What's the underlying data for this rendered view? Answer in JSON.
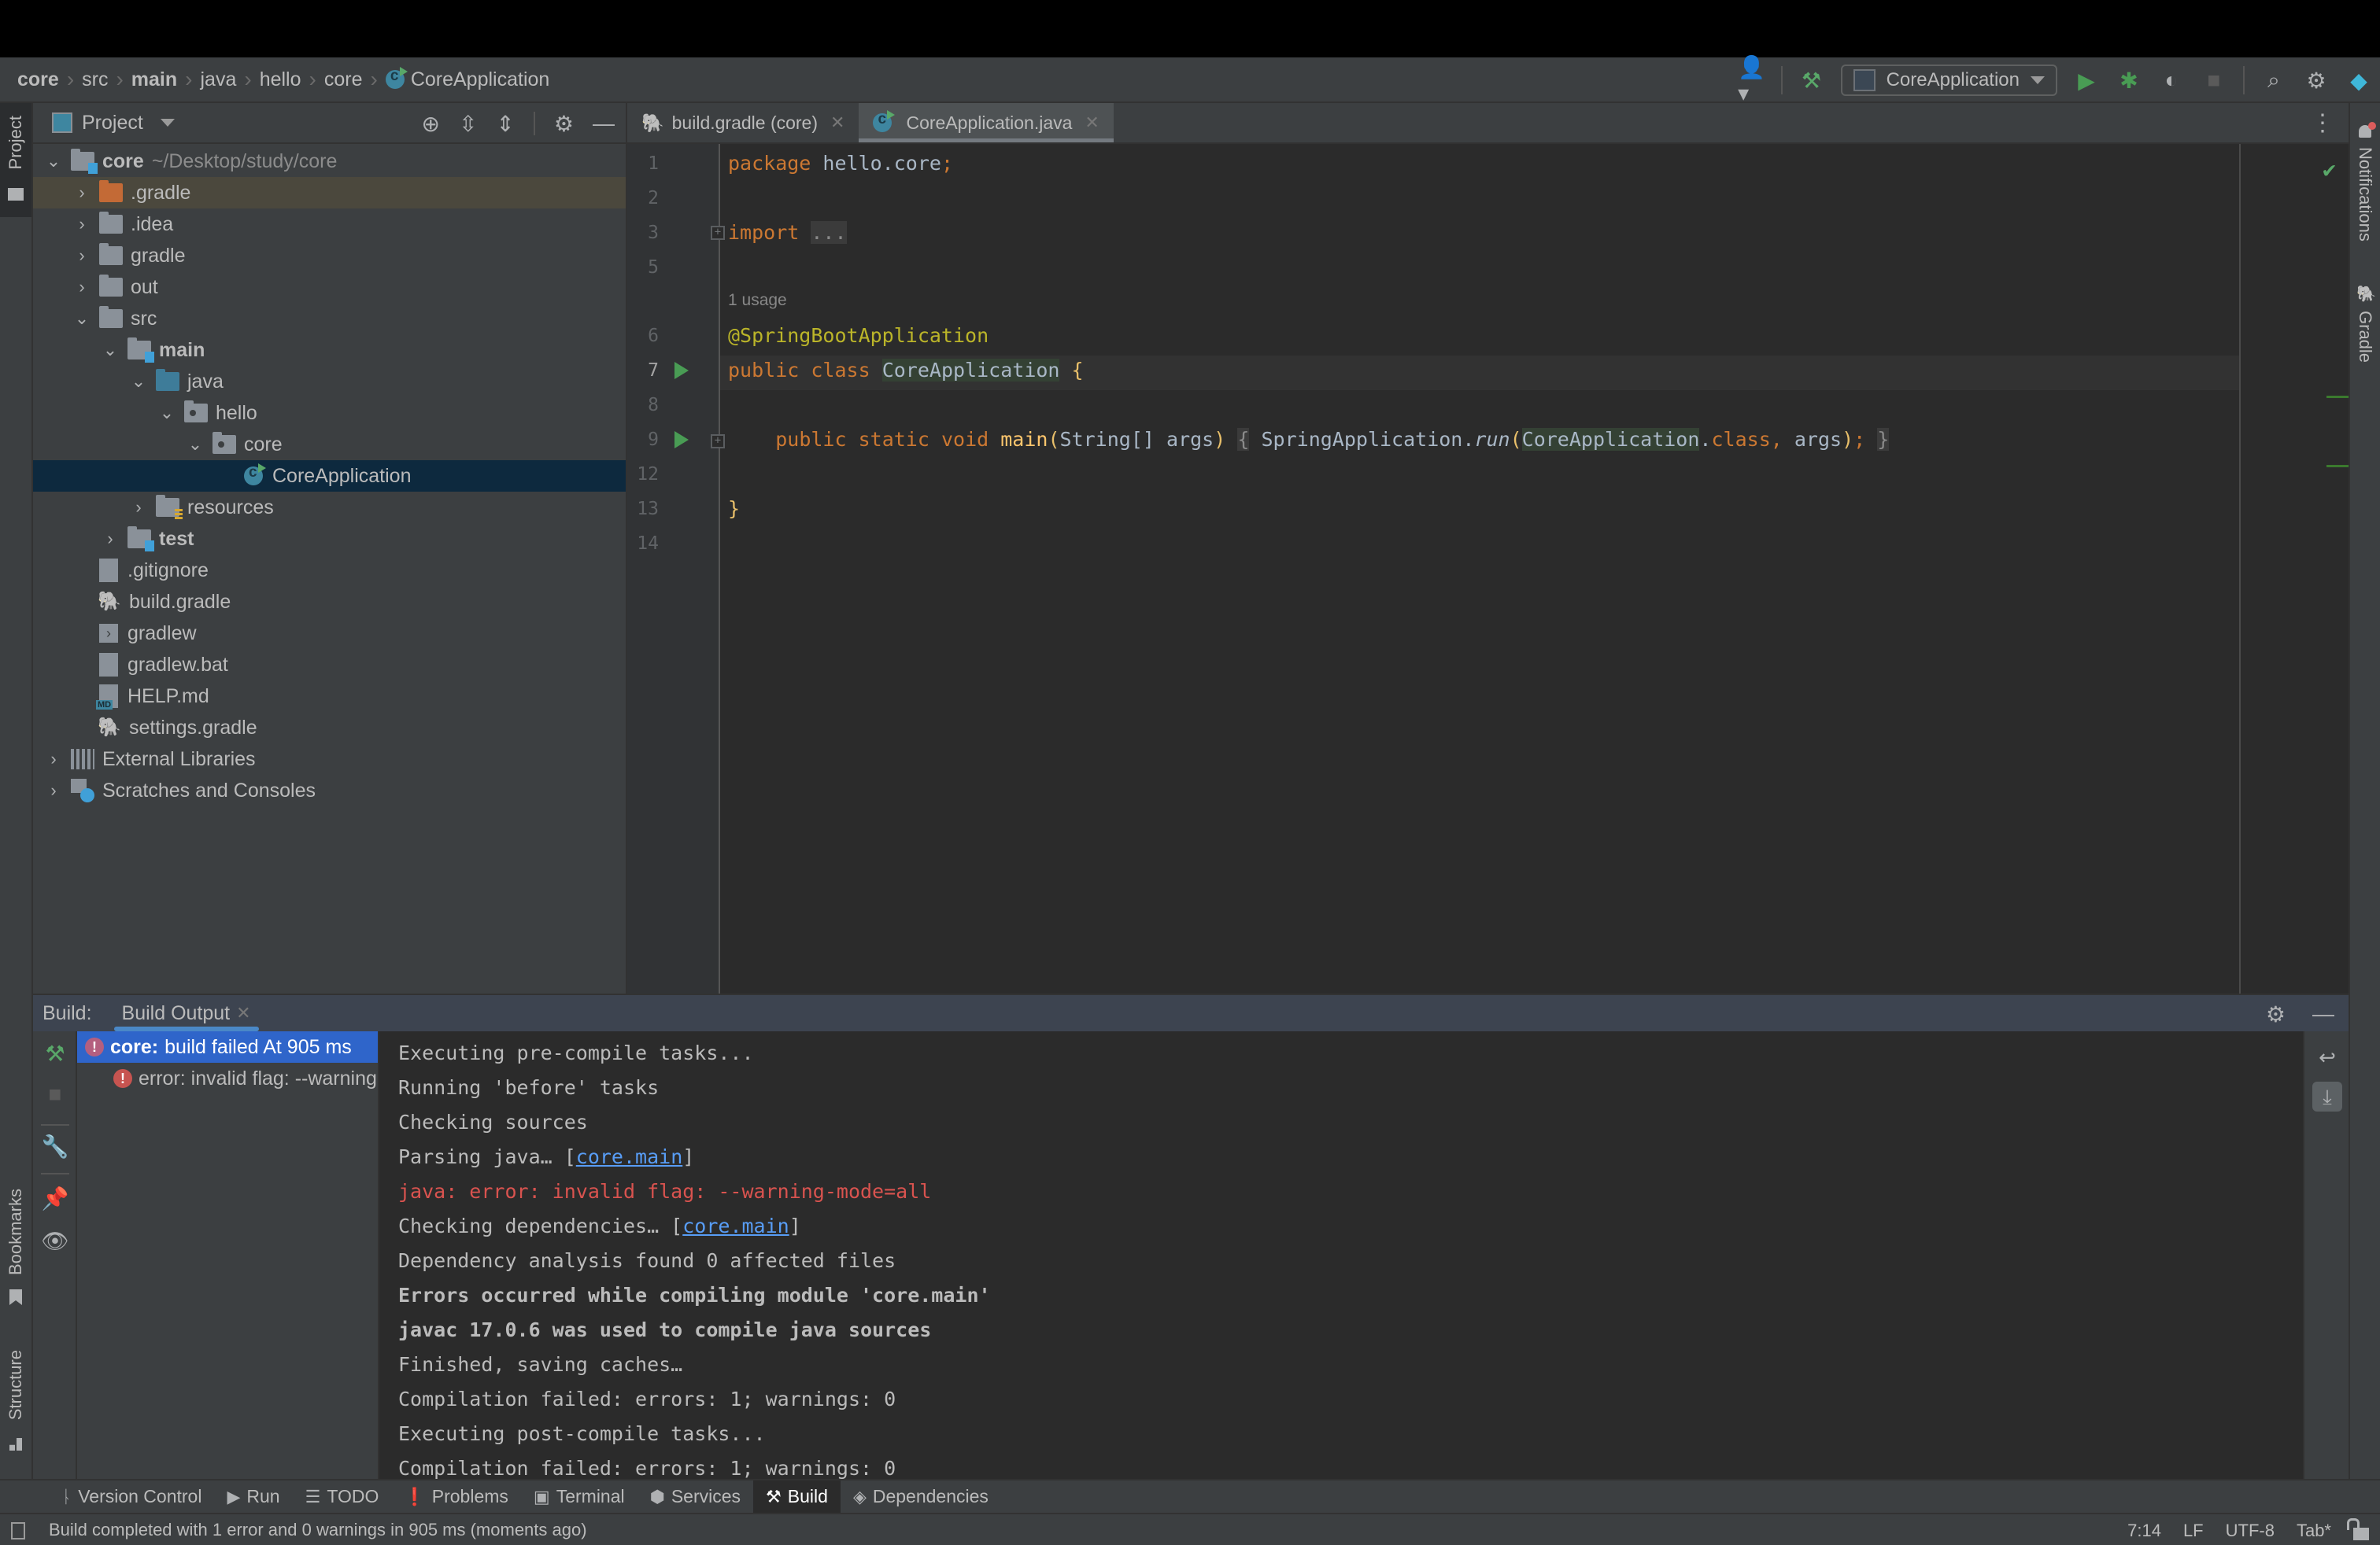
{
  "breadcrumb": [
    {
      "label": "core",
      "bold": true
    },
    {
      "label": "src",
      "bold": false
    },
    {
      "label": "main",
      "bold": true
    },
    {
      "label": "java",
      "bold": false
    },
    {
      "label": "hello",
      "bold": false
    },
    {
      "label": "core",
      "bold": false
    },
    {
      "label": "CoreApplication",
      "bold": false,
      "icon": "class-icon"
    }
  ],
  "toolbar": {
    "run_config": "CoreApplication",
    "icons": [
      "vcs-user-icon",
      "build-hammer-icon",
      "run-icon",
      "debug-icon",
      "coverage-icon",
      "stop-icon",
      "search-icon",
      "settings-icon",
      "jetbrains-logo-icon"
    ]
  },
  "project_panel": {
    "title": "Project",
    "stripe_label": "Project",
    "tree": [
      {
        "label": "core",
        "path": "~/Desktop/study/core",
        "level": 0,
        "expanded": true,
        "icon": "module-folder",
        "bold": true
      },
      {
        "label": ".gradle",
        "level": 1,
        "expanded": false,
        "icon": "folder-orange",
        "highlight": true
      },
      {
        "label": ".idea",
        "level": 1,
        "expanded": false,
        "icon": "folder"
      },
      {
        "label": "gradle",
        "level": 1,
        "expanded": false,
        "icon": "folder"
      },
      {
        "label": "out",
        "level": 1,
        "expanded": false,
        "icon": "folder"
      },
      {
        "label": "src",
        "level": 1,
        "expanded": true,
        "icon": "folder"
      },
      {
        "label": "main",
        "level": 2,
        "expanded": true,
        "icon": "source-root",
        "bold": true
      },
      {
        "label": "java",
        "level": 3,
        "expanded": true,
        "icon": "folder-blue"
      },
      {
        "label": "hello",
        "level": 4,
        "expanded": true,
        "icon": "package"
      },
      {
        "label": "core",
        "level": 5,
        "expanded": true,
        "icon": "package"
      },
      {
        "label": "CoreApplication",
        "level": 6,
        "icon": "class",
        "selected": true
      },
      {
        "label": "resources",
        "level": 3,
        "expanded": false,
        "icon": "resources-root"
      },
      {
        "label": "test",
        "level": 2,
        "expanded": false,
        "icon": "source-root",
        "bold": true
      },
      {
        "label": ".gitignore",
        "level": 1,
        "icon": "ignore-file"
      },
      {
        "label": "build.gradle",
        "level": 1,
        "icon": "gradle"
      },
      {
        "label": "gradlew",
        "level": 1,
        "icon": "shell"
      },
      {
        "label": "gradlew.bat",
        "level": 1,
        "icon": "text-file"
      },
      {
        "label": "HELP.md",
        "level": 1,
        "icon": "markdown"
      },
      {
        "label": "settings.gradle",
        "level": 1,
        "icon": "gradle"
      },
      {
        "label": "External Libraries",
        "level": 0,
        "expanded": false,
        "icon": "libraries"
      },
      {
        "label": "Scratches and Consoles",
        "level": 0,
        "expanded": false,
        "icon": "scratches"
      }
    ]
  },
  "editor": {
    "tabs": [
      {
        "label": "build.gradle (core)",
        "icon": "gradle-icon",
        "active": false
      },
      {
        "label": "CoreApplication.java",
        "icon": "class-icon",
        "active": true
      }
    ],
    "usage_hint": "1 usage",
    "lines": [
      {
        "n": "1",
        "code": "package hello.core;"
      },
      {
        "n": "2",
        "code": ""
      },
      {
        "n": "3",
        "code": "import ..."
      },
      {
        "n": "5",
        "code": ""
      },
      {
        "n": "6",
        "code": "@SpringBootApplication"
      },
      {
        "n": "7",
        "code": "public class CoreApplication {"
      },
      {
        "n": "8",
        "code": ""
      },
      {
        "n": "9",
        "code": "    public static void main(String[] args) { SpringApplication.run(CoreApplication.class, args); }"
      },
      {
        "n": "12",
        "code": ""
      },
      {
        "n": "13",
        "code": "}"
      },
      {
        "n": "14",
        "code": ""
      }
    ],
    "tokens": {
      "package_kw": "package",
      "package_name": "hello.core",
      "import_kw": "import",
      "import_fold": "...",
      "annotation": "@SpringBootApplication",
      "public_kw": "public",
      "class_kw": "class",
      "class_name": "CoreApplication",
      "static_kw": "static",
      "void_kw": "void",
      "method_name": "main",
      "param_type": "String[]",
      "param_name": "args",
      "call_target": "SpringApplication",
      "call_method": "run",
      "class_lit_kw": "class"
    },
    "inspection_status": "no-problems"
  },
  "right_stripe": {
    "items": [
      "Notifications",
      "Gradle"
    ]
  },
  "left_stripe_bottom": [
    "Bookmarks",
    "Structure"
  ],
  "build_panel": {
    "label": "Build:",
    "tab": "Build Output",
    "tree": [
      {
        "prefix": "core:",
        "text": "build failed At 905 ms",
        "selected": true,
        "level": 0
      },
      {
        "prefix": "",
        "text": "error: invalid flag: --warning-mode=all",
        "visible_text": "error: invalid flag: --warn",
        "selected": false,
        "level": 1
      }
    ],
    "console": [
      {
        "text": "Executing pre-compile tasks...",
        "style": "normal"
      },
      {
        "text": "Running 'before' tasks",
        "style": "normal"
      },
      {
        "text": "Checking sources",
        "style": "normal"
      },
      {
        "text": "Parsing java… [",
        "link": "core.main",
        "after": "]",
        "style": "normal"
      },
      {
        "text": "java: error: invalid flag: --warning-mode=all",
        "style": "error"
      },
      {
        "text": "Checking dependencies… [",
        "link": "core.main",
        "after": "]",
        "style": "normal"
      },
      {
        "text": "Dependency analysis found 0 affected files",
        "style": "normal"
      },
      {
        "text": "Errors occurred while compiling module 'core.main'",
        "style": "bold"
      },
      {
        "text": "javac 17.0.6 was used to compile java sources",
        "style": "bold"
      },
      {
        "text": "Finished, saving caches…",
        "style": "normal"
      },
      {
        "text": "Compilation failed: errors: 1; warnings: 0",
        "style": "normal"
      },
      {
        "text": "Executing post-compile tasks...",
        "style": "normal"
      },
      {
        "text": "Compilation failed: errors: 1; warnings: 0",
        "style": "normal"
      }
    ]
  },
  "tool_windows": [
    {
      "label": "Version Control",
      "icon": "branch-icon"
    },
    {
      "label": "Run",
      "icon": "run-icon"
    },
    {
      "label": "TODO",
      "icon": "list-icon"
    },
    {
      "label": "Problems",
      "icon": "problems-icon"
    },
    {
      "label": "Terminal",
      "icon": "terminal-icon"
    },
    {
      "label": "Services",
      "icon": "services-icon"
    },
    {
      "label": "Build",
      "icon": "hammer-icon",
      "active": true
    },
    {
      "label": "Dependencies",
      "icon": "dependencies-icon"
    }
  ],
  "status_bar": {
    "message": "Build completed with 1 error and 0 warnings in 905 ms (moments ago)",
    "position": "7:14",
    "line_separator": "LF",
    "encoding": "UTF-8",
    "indent": "Tab*"
  },
  "colors": {
    "accent": "#4a88c7",
    "selection": "#2f65ca",
    "error": "#d9534f",
    "run_green": "#499c54",
    "keyword": "#cc7832",
    "annotation": "#bbb529"
  }
}
